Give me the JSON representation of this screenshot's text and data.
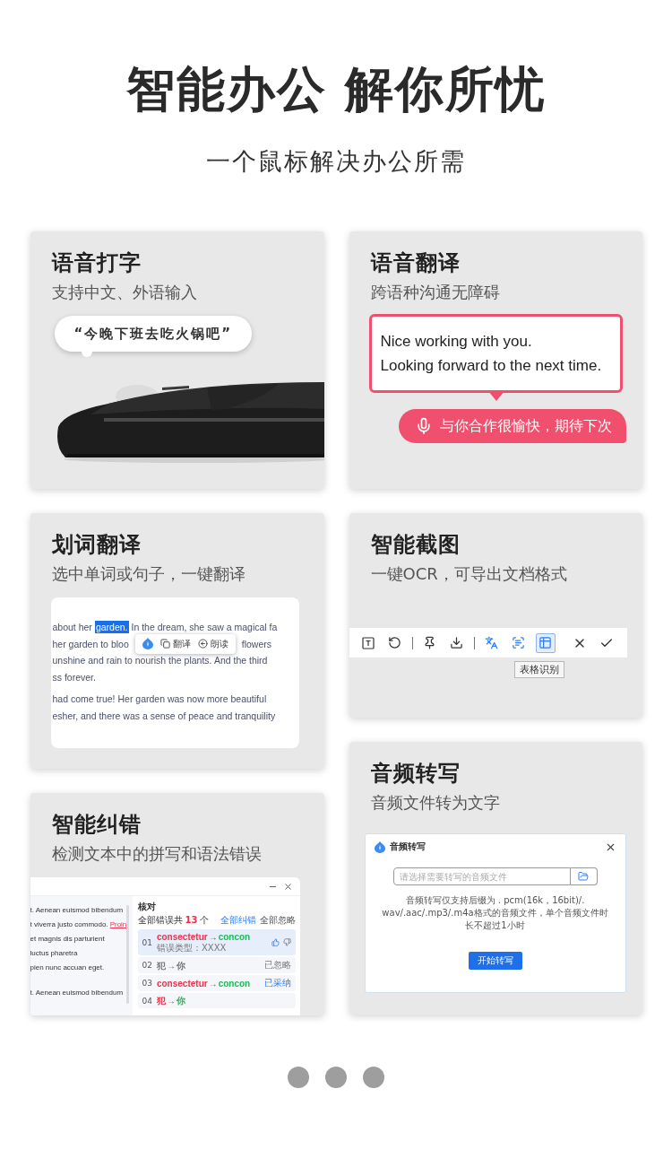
{
  "header": {
    "title": "智能办公 解你所忧",
    "subtitle": "一个鼠标解决办公所需"
  },
  "columns": [
    {
      "cards": [
        {
          "kind": "voice_typing",
          "title": "语音打字",
          "subtitle": "支持中文、外语输入",
          "bubble": "“今晚下班去吃火锅吧”"
        },
        {
          "kind": "word_translate",
          "title": "划词翻译",
          "subtitle": "选中单词或句子，一键翻译",
          "paragraphs": [
            {
              "lines": [
                {
                  "popup": false,
                  "segments": [
                    {
                      "text": "about her",
                      "selected": false
                    },
                    {
                      "text": "garden.",
                      "selected": true
                    },
                    {
                      "text": "In the dream, she saw a magical fa",
                      "selected": false
                    }
                  ]
                },
                {
                  "popup": true,
                  "segments": [
                    {
                      "text": "her garden to bloo",
                      "selected": false
                    },
                    {
                      "text": "flowers",
                      "selected": false
                    }
                  ]
                },
                {
                  "popup": false,
                  "segments": [
                    {
                      "text": "unshine and rain to nourish the plants. And the third",
                      "selected": false
                    }
                  ]
                },
                {
                  "popup": false,
                  "segments": [
                    {
                      "text": "ss forever.",
                      "selected": false
                    }
                  ]
                }
              ]
            },
            {
              "lines": [
                {
                  "popup": false,
                  "segments": [
                    {
                      "text": "had come true! Her garden was now more beautiful",
                      "selected": false
                    }
                  ]
                },
                {
                  "popup": false,
                  "segments": [
                    {
                      "text": "esher, and there was a sense of peace and tranquility",
                      "selected": false
                    }
                  ]
                }
              ]
            }
          ],
          "popup": {
            "actions": [
              {
                "kind": "translate",
                "label": "翻译"
              },
              {
                "kind": "read",
                "label": "朗读"
              }
            ]
          }
        },
        {
          "kind": "correction",
          "title": "智能纠错",
          "subtitle": "检测文本中的拼写和语法错误",
          "paragraphs": [
            {
              "lines": [
                {
                  "segments": [
                    {
                      "text": "t. Aenean euismod bibendum",
                      "error": false
                    }
                  ]
                },
                {
                  "segments": [
                    {
                      "text": "t viverra justo commodo.",
                      "error": false
                    },
                    {
                      "text": "Proin",
                      "error": true
                    }
                  ]
                },
                {
                  "segments": [
                    {
                      "text": "et magnis dis parturient",
                      "error": false
                    }
                  ]
                },
                {
                  "segments": [
                    {
                      "text": "luctus pharetra",
                      "error": false
                    }
                  ]
                },
                {
                  "segments": [
                    {
                      "text": "pien nunc accuan eget.",
                      "error": false
                    }
                  ]
                }
              ]
            },
            {
              "lines": [
                {
                  "segments": [
                    {
                      "text": "t. Aenean euismod bibendum",
                      "error": false
                    }
                  ]
                }
              ]
            }
          ],
          "panel": {
            "title": "核对",
            "summary_prefix": "全部错误共",
            "count": "13",
            "summary_suffix": "个",
            "fix_all": "全部纠错",
            "ignore_all": "全部忽略",
            "items": [
              {
                "number": "01",
                "wrong": "consectetur",
                "arrow": "→",
                "right": "concon",
                "kind": "pending",
                "selected": true,
                "error_type": "错误类型：XXXX"
              },
              {
                "number": "02",
                "wrong": "犯",
                "arrow": "→",
                "right": "你",
                "kind": "ignored",
                "status_label": "已忽略",
                "selected": false
              },
              {
                "number": "03",
                "wrong": "consectetur",
                "arrow": "→",
                "right": "concon",
                "kind": "accepted",
                "status_label": "已采纳",
                "selected": false
              },
              {
                "number": "04",
                "wrong": "犯",
                "arrow": "→",
                "right": "你",
                "kind": "pending",
                "selected": false
              }
            ]
          }
        }
      ]
    },
    {
      "cards": [
        {
          "kind": "voice_translate",
          "title": "语音翻译",
          "subtitle": "跨语种沟通无障碍",
          "source_lines": [
            "Nice working with you.",
            "Looking forward to the next time."
          ],
          "translation": "与你合作很愉快，期待下次"
        },
        {
          "kind": "screenshot",
          "title": "智能截图",
          "subtitle": "一键OCR，可导出文档格式",
          "groups": [
            {
              "divider_before": false,
              "tools": [
                {
                  "kind": "text",
                  "selected": false
                },
                {
                  "kind": "undo",
                  "selected": false
                }
              ]
            },
            {
              "divider_before": true,
              "tools": [
                {
                  "kind": "pin",
                  "selected": false
                },
                {
                  "kind": "download",
                  "selected": false
                }
              ]
            },
            {
              "divider_before": true,
              "tools": [
                {
                  "kind": "translate",
                  "selected": false
                },
                {
                  "kind": "scan",
                  "selected": false
                },
                {
                  "kind": "table",
                  "selected": true
                }
              ]
            },
            {
              "divider_before": false,
              "actions": [
                {
                  "kind": "close"
                },
                {
                  "kind": "confirm"
                }
              ]
            }
          ],
          "tooltip": "表格识别"
        },
        {
          "kind": "audio",
          "title": "音频转写",
          "subtitle": "音频文件转为文字",
          "dialog": {
            "title": "音频转写",
            "placeholder": "请选择需要转写的音频文件",
            "note": "音频转写仅支持后缀为 . pcm(16k，16bit)/. wav/.aac/.mp3/.m4a格式的音频文件，单个音频文件时长不超过1小时",
            "button": "开始转写"
          }
        }
      ]
    }
  ],
  "pager": [
    {
      "selected": false
    },
    {
      "selected": false
    },
    {
      "selected": false
    }
  ]
}
